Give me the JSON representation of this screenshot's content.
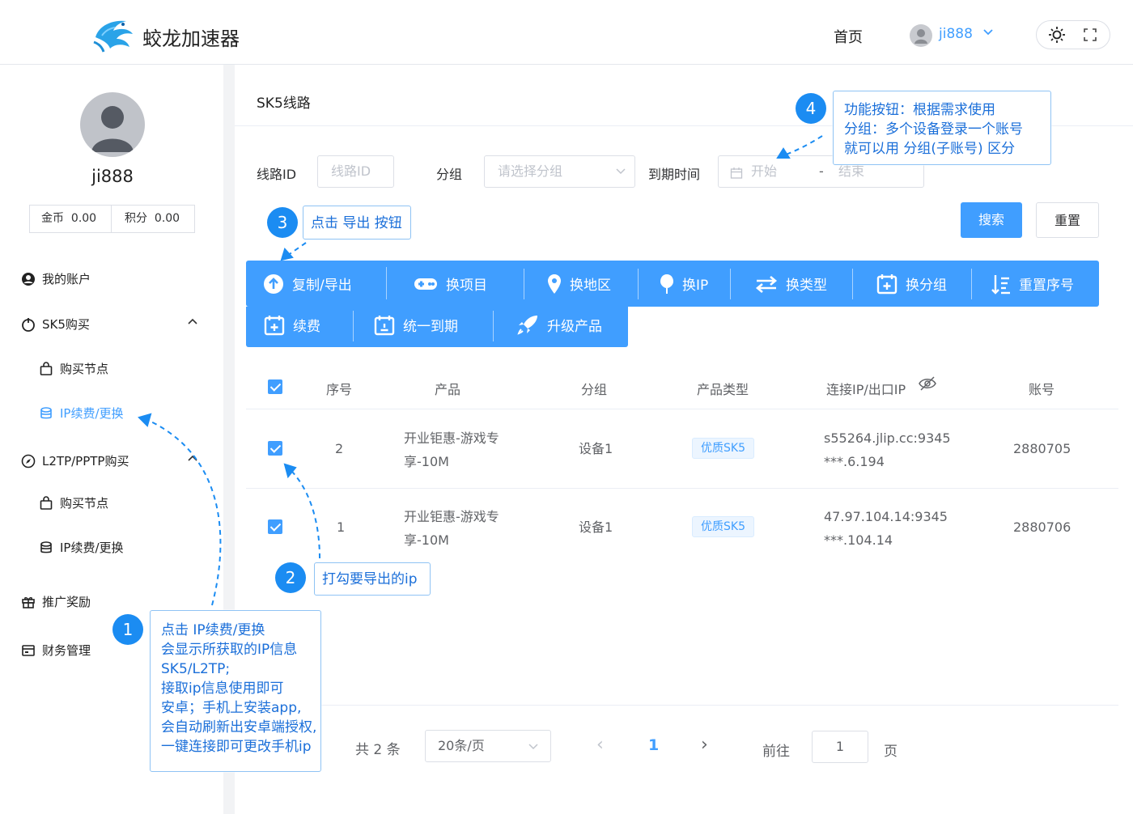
{
  "header": {
    "brand": "蛟龙加速器",
    "nav_home": "首页",
    "user_name": "ji888",
    "caret": "⌄"
  },
  "sidebar": {
    "user_name": "ji888",
    "wallet": [
      {
        "label": "金币",
        "value": "0.00"
      },
      {
        "label": "积分",
        "value": "0.00"
      }
    ],
    "menu": {
      "account": "我的账户",
      "sk5": "SK5购买",
      "sk5_buy": "购买节点",
      "sk5_ip": "IP续费/更换",
      "l2tp": "L2TP/PPTP购买",
      "l2tp_buy": "购买节点",
      "l2tp_ip": "IP续费/更换",
      "promo": "推广奖励",
      "finance": "财务管理"
    }
  },
  "main": {
    "title": "SK5线路",
    "filters": {
      "line_id_label": "线路ID",
      "line_id_placeholder": "线路ID",
      "group_label": "分组",
      "group_placeholder": "请选择分组",
      "expire_label": "到期时间",
      "start_placeholder": "开始",
      "range_sep": "-",
      "end_placeholder": "结束"
    },
    "search_btn": "搜索",
    "reset_btn": "重置",
    "toolbar": [
      {
        "label": "复制/导出",
        "icon": "upload-circle-icon"
      },
      {
        "label": "换项目",
        "icon": "gamepad-icon"
      },
      {
        "label": "换地区",
        "icon": "location-pin-icon"
      },
      {
        "label": "换IP",
        "icon": "balloon-icon"
      },
      {
        "label": "换类型",
        "icon": "swap-arrows-icon"
      },
      {
        "label": "换分组",
        "icon": "calendar-plus-icon"
      },
      {
        "label": "重置序号",
        "icon": "sort-list-icon"
      }
    ],
    "toolbar2": [
      {
        "label": "续费",
        "icon": "calendar-plus-icon"
      },
      {
        "label": "统一到期",
        "icon": "calendar-minus-icon"
      },
      {
        "label": "升级产品",
        "icon": "rocket-icon"
      }
    ],
    "table": {
      "headers": [
        "序号",
        "产品",
        "分组",
        "产品类型",
        "连接IP/出口IP",
        "账号"
      ],
      "rows": [
        {
          "index": "2",
          "product_line1": "开业钜惠-游戏专",
          "product_line2": "享-10M",
          "group": "设备1",
          "type": "优质SK5",
          "ip_line1": "s55264.jlip.cc:9345",
          "ip_line2": "***.6.194",
          "account": "2880705"
        },
        {
          "index": "1",
          "product_line1": "开业钜惠-游戏专",
          "product_line2": "享-10M",
          "group": "设备1",
          "type": "优质SK5",
          "ip_line1": "47.97.104.14:9345",
          "ip_line2": "***.104.14",
          "account": "2880706"
        }
      ]
    },
    "pagination": {
      "total": "共 2 条",
      "page_size": "20条/页",
      "prev": "‹",
      "current": "1",
      "next": "›",
      "goto_label": "前往",
      "goto_value": "1",
      "page_suffix": "页"
    }
  },
  "annotations": {
    "n1": "1",
    "t1": [
      "点击 IP续费/更换",
      "会显示所获取的IP信息",
      "SK5/L2TP;",
      "接取ip信息使用即可",
      "安卓；手机上安装app,",
      "会自动刷新出安卓端授权,",
      "一键连接即可更改手机ip"
    ],
    "n2": "2",
    "t2": "打勾要导出的ip",
    "n3": "3",
    "t3": "点击 导出 按钮",
    "n4": "4",
    "t4": [
      "功能按钮：根据需求使用",
      "分组：多个设备登录一个账号",
      "就可以用 分组(子账号) 区分"
    ]
  },
  "colors": {
    "primary": "#409eff",
    "annotation": "#1b8cf2"
  }
}
